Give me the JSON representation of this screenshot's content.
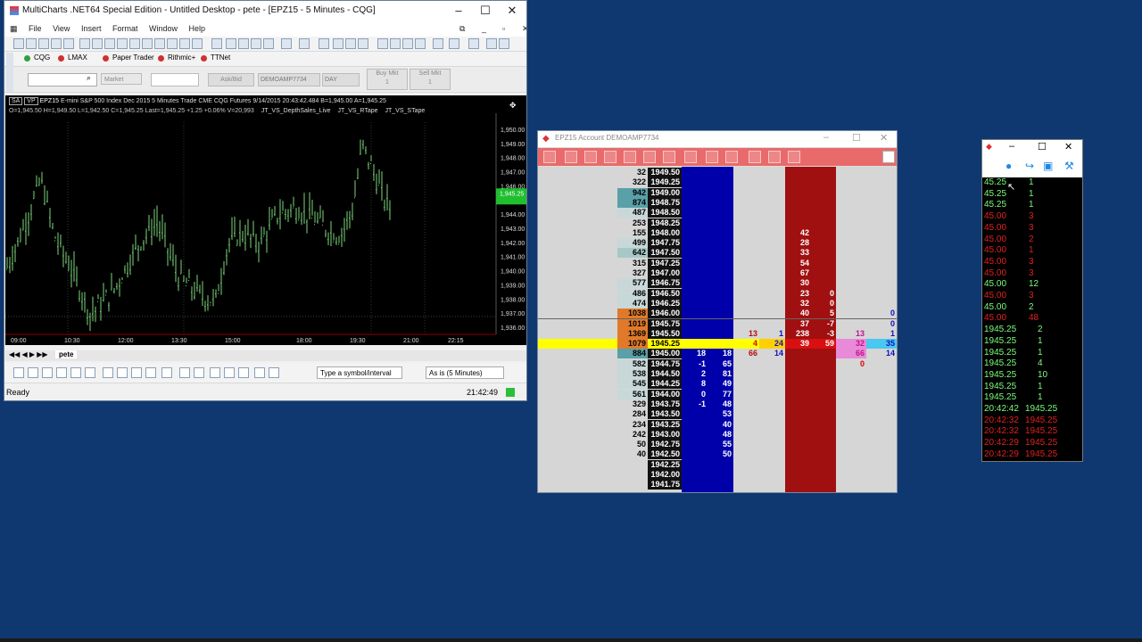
{
  "main": {
    "title": "MultiCharts .NET64 Special Edition - Untitled Desktop - pete - [EPZ15 - 5 Minutes - CQG]",
    "menus": [
      "File",
      "View",
      "Insert",
      "Format",
      "Window",
      "Help"
    ],
    "brokers": [
      {
        "label": "CQG",
        "color": "#2ea043"
      },
      {
        "label": "LMAX",
        "color": "#d03030"
      },
      {
        "label": "Paper Trader",
        "color": "#d03030"
      },
      {
        "label": "Rithmic+",
        "color": "#d03030"
      },
      {
        "label": "TTNet",
        "color": "#d03030"
      }
    ],
    "order_bar": {
      "order_type": "Market",
      "askbid": "Ask/Bid",
      "account": "DEMOAMP7734",
      "duration": "DAY",
      "buy": "Buy Mkt",
      "buy_qty": "1",
      "sell": "Sell Mkt",
      "sell_qty": "1"
    },
    "chart": {
      "info1_prefix": "SA",
      "info1_prefix2": "VP",
      "symbol": "EPZ15",
      "description": "E-mini S&P 500 Index Dec 2015  5 Minutes",
      "trade": "Trade  CME  CQG  Futures  9/14/2015  20:43:42.484  B=1,945.00  A=1,945.25",
      "ohlc": "O=1,945.50  H=1,949.50  L=1,942.50  C=1,945.25  Last=1,945.25  +1.25  +0.06%  V=20,993",
      "studies": [
        "JT_VS_DepthSales_Live",
        "JT_VS_RTape",
        "JT_VS_STape"
      ],
      "price_labels": [
        "1,950.00",
        "1,949.00",
        "1,948.00",
        "1,947.00",
        "1,946.00",
        "1,945.00",
        "1,944.00",
        "1,943.00",
        "1,942.00",
        "1,941.00",
        "1,940.00",
        "1,939.00",
        "1,938.00",
        "1,937.00",
        "1,936.00"
      ],
      "last_price": "1,945.25",
      "time_labels": [
        "09:00",
        "10:30",
        "12:00",
        "13:30",
        "15:00",
        "18:00",
        "19:30",
        "21:00",
        "22:15"
      ],
      "tab": "pete"
    },
    "drawing_bar": {
      "symbol_placeholder": "Type a symbol/interval",
      "interval": "As is (5 Minutes)"
    },
    "status": {
      "left": "Ready",
      "time": "21:42:49"
    }
  },
  "dom": {
    "title": "EPZ15  Account DEMOAMP7734",
    "rows": [
      {
        "vol": "32",
        "price": "1949.50"
      },
      {
        "vol": "322",
        "price": "1949.25"
      },
      {
        "vol": "942",
        "price": "1949.00"
      },
      {
        "vol": "874",
        "price": "1948.75"
      },
      {
        "vol": "487",
        "price": "1948.50"
      },
      {
        "vol": "253",
        "price": "1948.25"
      },
      {
        "vol": "155",
        "price": "1948.00",
        "ask": "42"
      },
      {
        "vol": "499",
        "price": "1947.75",
        "ask": "28"
      },
      {
        "vol": "642",
        "price": "1947.50",
        "ask": "33"
      },
      {
        "vol": "315",
        "price": "1947.25",
        "ask": "54"
      },
      {
        "vol": "327",
        "price": "1947.00",
        "ask": "67"
      },
      {
        "vol": "577",
        "price": "1946.75",
        "ask": "30"
      },
      {
        "vol": "486",
        "price": "1946.50",
        "ask": "23",
        "askd": "0"
      },
      {
        "vol": "474",
        "price": "1946.25",
        "ask": "32",
        "askd": "0"
      },
      {
        "vol": "1038",
        "price": "1946.00",
        "ask": "40",
        "askd": "5",
        "r2": "0"
      },
      {
        "vol": "1019",
        "price": "1945.75",
        "ask": "37",
        "askd": "-7",
        "r2": "0"
      },
      {
        "vol": "1369",
        "price": "1945.50",
        "s1": "13",
        "s2": "1",
        "ask": "238",
        "askd": "-3",
        "r1": "13",
        "r2": "1"
      },
      {
        "vol": "1079",
        "price": "1945.25",
        "s1": "4",
        "s2": "24",
        "ask": "39",
        "askd": "59",
        "r1": "32",
        "r2": "35"
      },
      {
        "vol": "884",
        "price": "1945.00",
        "bidd": "18",
        "bid": "18",
        "s1": "66",
        "s2": "14",
        "r1": "66",
        "r2": "14"
      },
      {
        "vol": "582",
        "price": "1944.75",
        "bidd": "-1",
        "bid": "65",
        "r1": "0"
      },
      {
        "vol": "538",
        "price": "1944.50",
        "bidd": "2",
        "bid": "81"
      },
      {
        "vol": "545",
        "price": "1944.25",
        "bidd": "8",
        "bid": "49"
      },
      {
        "vol": "561",
        "price": "1944.00",
        "bidd": "0",
        "bid": "77"
      },
      {
        "vol": "329",
        "price": "1943.75",
        "bidd": "-1",
        "bid": "48"
      },
      {
        "vol": "284",
        "price": "1943.50",
        "bid": "53"
      },
      {
        "vol": "234",
        "price": "1943.25",
        "bid": "40"
      },
      {
        "vol": "242",
        "price": "1943.00",
        "bid": "48"
      },
      {
        "vol": "50",
        "price": "1942.75",
        "bid": "55"
      },
      {
        "vol": "40",
        "price": "1942.50",
        "bid": "50"
      },
      {
        "vol": "",
        "price": "1942.25"
      },
      {
        "vol": "",
        "price": "1942.00"
      },
      {
        "vol": "",
        "price": "1941.75"
      }
    ]
  },
  "tape": {
    "rows": [
      {
        "p": "45.25",
        "q": "1",
        "c": "#7cfc7c"
      },
      {
        "p": "45.25",
        "q": "1",
        "c": "#7cfc7c"
      },
      {
        "p": "45.25",
        "q": "1",
        "c": "#7cfc7c"
      },
      {
        "p": "45.00",
        "q": "3",
        "c": "#e02020"
      },
      {
        "p": "45.00",
        "q": "3",
        "c": "#e02020"
      },
      {
        "p": "45.00",
        "q": "2",
        "c": "#e02020"
      },
      {
        "p": "45.00",
        "q": "1",
        "c": "#e02020"
      },
      {
        "p": "45.00",
        "q": "3",
        "c": "#e02020"
      },
      {
        "p": "45.00",
        "q": "3",
        "c": "#e02020"
      },
      {
        "p": "45.00",
        "q": "12",
        "c": "#7cfc7c"
      },
      {
        "p": "45.00",
        "q": "3",
        "c": "#e02020"
      },
      {
        "p": "45.00",
        "q": "2",
        "c": "#7cfc7c"
      },
      {
        "p": "45.00",
        "q": "48",
        "c": "#e02020"
      },
      {
        "p": "1945.25",
        "q": "2",
        "c": "#7cfc7c"
      },
      {
        "p": "1945.25",
        "q": "1",
        "c": "#7cfc7c"
      },
      {
        "p": "1945.25",
        "q": "1",
        "c": "#7cfc7c"
      },
      {
        "p": "1945.25",
        "q": "4",
        "c": "#7cfc7c"
      },
      {
        "p": "1945.25",
        "q": "10",
        "c": "#7cfc7c"
      },
      {
        "p": "1945.25",
        "q": "1",
        "c": "#7cfc7c"
      },
      {
        "p": "1945.25",
        "q": "1",
        "c": "#7cfc7c"
      },
      {
        "p": "20:42:42",
        "q": "1945.25",
        "c": "#7cfc7c"
      },
      {
        "p": "20:42:32",
        "q": "1945.25",
        "c": "#e02020"
      },
      {
        "p": "20:42:32",
        "q": "1945.25",
        "c": "#e02020"
      },
      {
        "p": "20:42:29",
        "q": "1945.25",
        "c": "#e02020"
      },
      {
        "p": "20:42:29",
        "q": "1945.25",
        "c": "#e02020"
      }
    ]
  }
}
